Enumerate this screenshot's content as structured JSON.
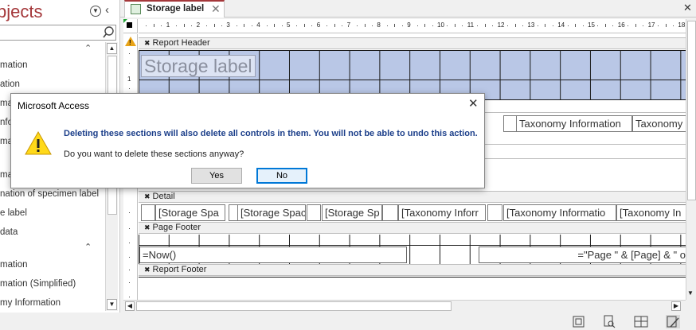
{
  "nav": {
    "title": "bjects",
    "search_placeholder": "",
    "items": [
      "mation",
      "ation",
      "mati",
      "nfo",
      "mat",
      "mat",
      "nation of specimen label",
      "e label",
      "data",
      "mation",
      "mation (Simplified)",
      "my Information"
    ]
  },
  "tab": {
    "label": "Storage label"
  },
  "report": {
    "sections": {
      "report_header": "Report Header",
      "detail": "Detail",
      "page_footer": "Page Footer",
      "report_footer": "Report Footer"
    },
    "header_label": "Storage label",
    "page_header_controls": [
      "Taxonomy Information",
      "Taxonomy Inf"
    ],
    "detail_controls": [
      "[Storage Spa",
      "[Storage Spac",
      "[Storage Sp",
      "[Taxonomy Inforr",
      "[Taxonomy Informatio",
      "[Taxonomy In"
    ],
    "footer_now": "=Now()",
    "footer_page": "=\"Page \" & [Page] & \" o",
    "ruler_numbers": [
      "1",
      "2",
      "3",
      "4",
      "5",
      "6",
      "7",
      "8",
      "9",
      "10",
      "11",
      "12",
      "13",
      "14",
      "15",
      "16",
      "17",
      "18"
    ]
  },
  "dialog": {
    "title": "Microsoft Access",
    "message": "Deleting these sections will also delete all controls in them. You will not be able to undo this action.",
    "question": "Do you want to delete these sections anyway?",
    "yes_label": "Yes",
    "no_label": "No"
  }
}
